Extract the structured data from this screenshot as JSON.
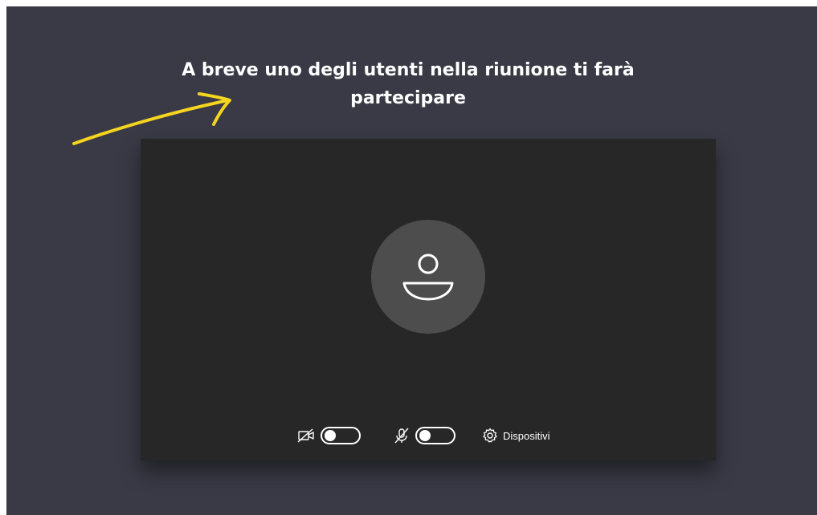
{
  "header": {
    "title": "A breve uno degli utenti nella riunione ti farà partecipare"
  },
  "preview": {
    "avatar_icon": "person-icon"
  },
  "controls": {
    "camera_icon": "camera-off-icon",
    "camera_enabled": false,
    "mic_icon": "microphone-off-icon",
    "mic_enabled": false,
    "devices_icon": "gear-icon",
    "devices_label": "Dispositivi"
  },
  "annotation": {
    "icon": "yellow-arrow-icon",
    "color": "#f5d51e"
  },
  "colors": {
    "background": "#3a3a46",
    "preview_background": "#272727",
    "avatar_background": "#4d4d4d",
    "text": "#ffffff"
  }
}
